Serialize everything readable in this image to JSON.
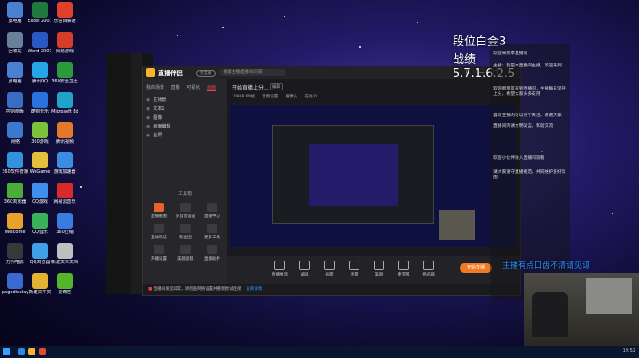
{
  "desktop": {
    "icons": [
      {
        "label": "此电脑",
        "color": "#4a7fd1"
      },
      {
        "label": "Excel 2007",
        "color": "#1f7a3d"
      },
      {
        "label": "乐信百事通",
        "color": "#e2402b"
      },
      {
        "label": "回收站",
        "color": "#6a7f9a"
      },
      {
        "label": "Word 2007",
        "color": "#2a59c2"
      },
      {
        "label": "网易游戏",
        "color": "#d43d2a"
      },
      {
        "label": "此电脑",
        "color": "#4a7fd1"
      },
      {
        "label": "腾讯QQ",
        "color": "#25a4e8"
      },
      {
        "label": "360安全卫士",
        "color": "#2c9a3b"
      },
      {
        "label": "控制面板",
        "color": "#3a6cc4"
      },
      {
        "label": "酷狗音乐",
        "color": "#2a72e0"
      },
      {
        "label": "Microsoft Edge",
        "color": "#1fa3c8"
      },
      {
        "label": "网络",
        "color": "#3b78d0"
      },
      {
        "label": "360游戏",
        "color": "#7bc23a"
      },
      {
        "label": "腾讯视频",
        "color": "#e3782a"
      },
      {
        "label": "360软件管家",
        "color": "#3292e0"
      },
      {
        "label": "WeGame",
        "color": "#e5c03a"
      },
      {
        "label": "游戏加速器",
        "color": "#3a8de0"
      },
      {
        "label": "360浏览器",
        "color": "#4aad3a"
      },
      {
        "label": "QQ游戏",
        "color": "#3f8ef0"
      },
      {
        "label": "网易云音乐",
        "color": "#d82a2a"
      },
      {
        "label": "Welcome",
        "color": "#e6a22a"
      },
      {
        "label": "QQ音乐",
        "color": "#3ab25a"
      },
      {
        "label": "360压缩",
        "color": "#3a7be0"
      },
      {
        "label": "万兴喵影",
        "color": "#383838"
      },
      {
        "label": "QQ浏览器",
        "color": "#3fa0e8"
      },
      {
        "label": "新建文本文档",
        "color": "#bfbfbf"
      },
      {
        "label": "pagedisplay_pro",
        "color": "#3a6ad0"
      },
      {
        "label": "新建文件夹",
        "color": "#e3b233"
      },
      {
        "label": "爱奇艺",
        "color": "#55b52a"
      }
    ]
  },
  "app": {
    "name": "直播伴侣",
    "badge": "官方版",
    "search_placeholder": "搜索主播/直播间/内容",
    "window_controls": "⚙ — ▢ ✕",
    "tabs": [
      "我的场景",
      "直播",
      "可视化",
      "画面"
    ],
    "active_tab": "画面",
    "scenes": [
      "主场景",
      "文本1",
      "图像",
      "画面编辑",
      "全屏"
    ],
    "tools_title": "工具箱",
    "tools": [
      {
        "label": "直播截图",
        "hot": true
      },
      {
        "label": "多音量设置",
        "hot": false
      },
      {
        "label": "直播中心",
        "hot": false
      },
      {
        "label": "互动玩法",
        "hot": false
      },
      {
        "label": "粉丝团",
        "hot": false
      },
      {
        "label": "更多工具",
        "hot": false
      },
      {
        "label": "开播设置",
        "hot": false
      },
      {
        "label": "美颜滤镜",
        "hot": false
      },
      {
        "label": "直播助手",
        "hot": false
      }
    ],
    "notice": "开始直播上分...",
    "notice_btn": "编辑",
    "row": [
      "1080P 60帧",
      "音频设置",
      "摄像头",
      "在线:0"
    ],
    "bottom_buttons": [
      "直播推流",
      "录屏",
      "画面",
      "场景",
      "美颜",
      "麦克风",
      "扬声器"
    ],
    "start_button": "开始直播",
    "alert_text": "直播间发现异常，请检查网络设置并重新尝试连接",
    "alert_link": "查看详情"
  },
  "overlay": {
    "rank": "段位白金3",
    "record_label": "战绩",
    "record_value": "5.7.1.6.2.5",
    "chat": [
      "欢迎来到本直播间",
      "主播：我是本直播间主播，欢迎来到",
      "欢迎新朋友来到直播间，主播每日坚持上分，希望大家多多支持",
      "喜欢主播的可以点个关注，谢谢大家",
      "直播间内请文明发言，和谐交流",
      "欢迎小伙伴进入直播间观看",
      "请大家遵守直播规范，共同维护良好氛围"
    ],
    "scroll_text": "主播有点口齿不清请见谅"
  },
  "taskbar": {
    "time": "19:52"
  }
}
